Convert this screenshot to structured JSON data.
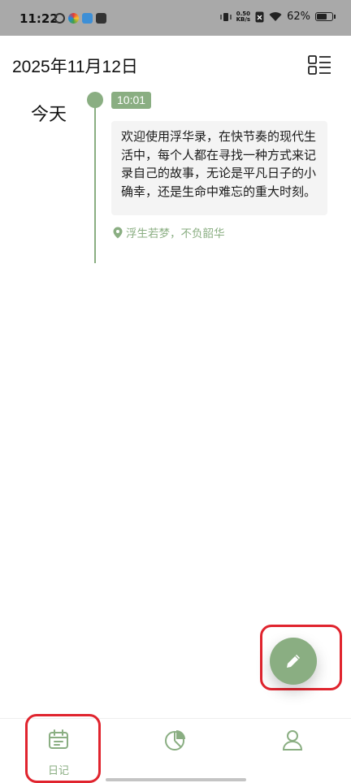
{
  "status_bar": {
    "time": "11:22",
    "speed_value": "0.50",
    "speed_unit": "KB/s",
    "battery": "62%",
    "battery_level": 0.62
  },
  "header": {
    "date": "2025年11月12日"
  },
  "timeline": {
    "day_label": "今天",
    "entries": [
      {
        "time": "10:01",
        "text": "欢迎使用浮华录，在快节奏的现代生活中，每个人都在寻找一种方式来记录自己的故事，无论是平凡日子的小确幸，还是生命中难忘的重大时刻。《浮华录》正…",
        "location": "浮生若梦，不负韶华"
      }
    ]
  },
  "bottom_nav": {
    "items": [
      {
        "label": "日记",
        "icon": "calendar-icon",
        "active": true
      },
      {
        "label": "",
        "icon": "pie-chart-icon",
        "active": false
      },
      {
        "label": "",
        "icon": "user-icon",
        "active": false
      }
    ]
  },
  "colors": {
    "accent": "#8aae82",
    "highlight": "#e0242e",
    "card_bg": "#f4f4f4"
  }
}
